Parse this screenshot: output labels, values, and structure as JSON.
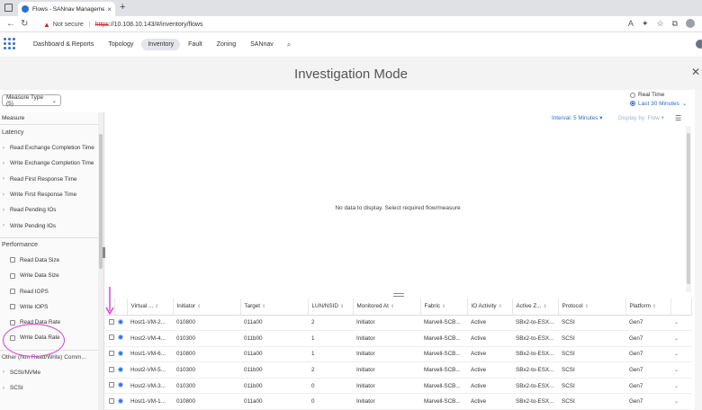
{
  "browser": {
    "tab_title": "Flows - SANnav Management P...",
    "tab_close": "×",
    "new_tab": "+",
    "not_secure": "Not secure",
    "url_https": "https",
    "url_rest": "://10.108.10.143/#/inventory/flows"
  },
  "nav": {
    "items": [
      "Dashboard & Reports",
      "Topology",
      "Inventory",
      "Fault",
      "Zoning",
      "SANnav"
    ],
    "active": "Inventory"
  },
  "mode_title": "Investigation Mode",
  "measure_type": {
    "label": "Measure Type (5)"
  },
  "time": {
    "real_time": "Real Time",
    "last_30": "Last 30 Minutes"
  },
  "toolbar": {
    "interval": "Interval: 5 Minutes",
    "display_by": "Display by: Flow"
  },
  "left_panel": {
    "header": "Measure",
    "latency": {
      "title": "Latency",
      "items": [
        "Read Exchange Completion Time",
        "Write Exchange Completion Time",
        "Read First Response Time",
        "Write First Response Time",
        "Read Pending IOs",
        "Write Pending IOs"
      ]
    },
    "performance": {
      "title": "Performance",
      "items": [
        "Read Data Size",
        "Write Data Size",
        "Read IOPS",
        "Write IOPS",
        "Read Data Rate",
        "Write Data Rate"
      ]
    },
    "other": {
      "title": "Other (non Read/Write) Comm...",
      "items": [
        "SCSI/NVMe",
        "SCSI"
      ]
    }
  },
  "no_data": "No data to display. Select required flow/measure",
  "table": {
    "columns": [
      "Virtual ...",
      "Initiator",
      "Target",
      "LUN/NSID",
      "Monitored At",
      "Fabric",
      "IO Activity",
      "Active Z...",
      "Protocol",
      "Platform"
    ],
    "rows": [
      [
        "Host1-VM-2...",
        "010800",
        "011a00",
        "2",
        "Initiator",
        "Marvell-SCB...",
        "Active",
        "SBx2-to-ESX...",
        "SCSI",
        "Gen7"
      ],
      [
        "Host2-VM-4...",
        "010300",
        "011b00",
        "1",
        "Initiator",
        "Marvell-SCB...",
        "Active",
        "SBx2-to-ESX...",
        "SCSI",
        "Gen7"
      ],
      [
        "Host1-VM-6...",
        "010800",
        "011a00",
        "1",
        "Initiator",
        "Marvell-SCB...",
        "Active",
        "SBx2-to-ESX...",
        "SCSI",
        "Gen7"
      ],
      [
        "Host2-VM-5...",
        "010300",
        "011b00",
        "2",
        "Initiator",
        "Marvell-SCB...",
        "Active",
        "SBx2-to-ESX...",
        "SCSI",
        "Gen7"
      ],
      [
        "Host2-VM-3...",
        "010300",
        "011b00",
        "0",
        "Initiator",
        "Marvell-SCB...",
        "Active",
        "SBx2-to-ESX...",
        "SCSI",
        "Gen7"
      ],
      [
        "Host1-VM-1...",
        "010800",
        "011a00",
        "0",
        "Initiator",
        "Marvell-SCB...",
        "Active",
        "SBx2-to-ESX...",
        "SCSI",
        "Gen7"
      ]
    ]
  },
  "colors": {
    "accent": "#2a6fd6",
    "annotation": "#e33ad6",
    "title_band": "#f3f3f3"
  }
}
